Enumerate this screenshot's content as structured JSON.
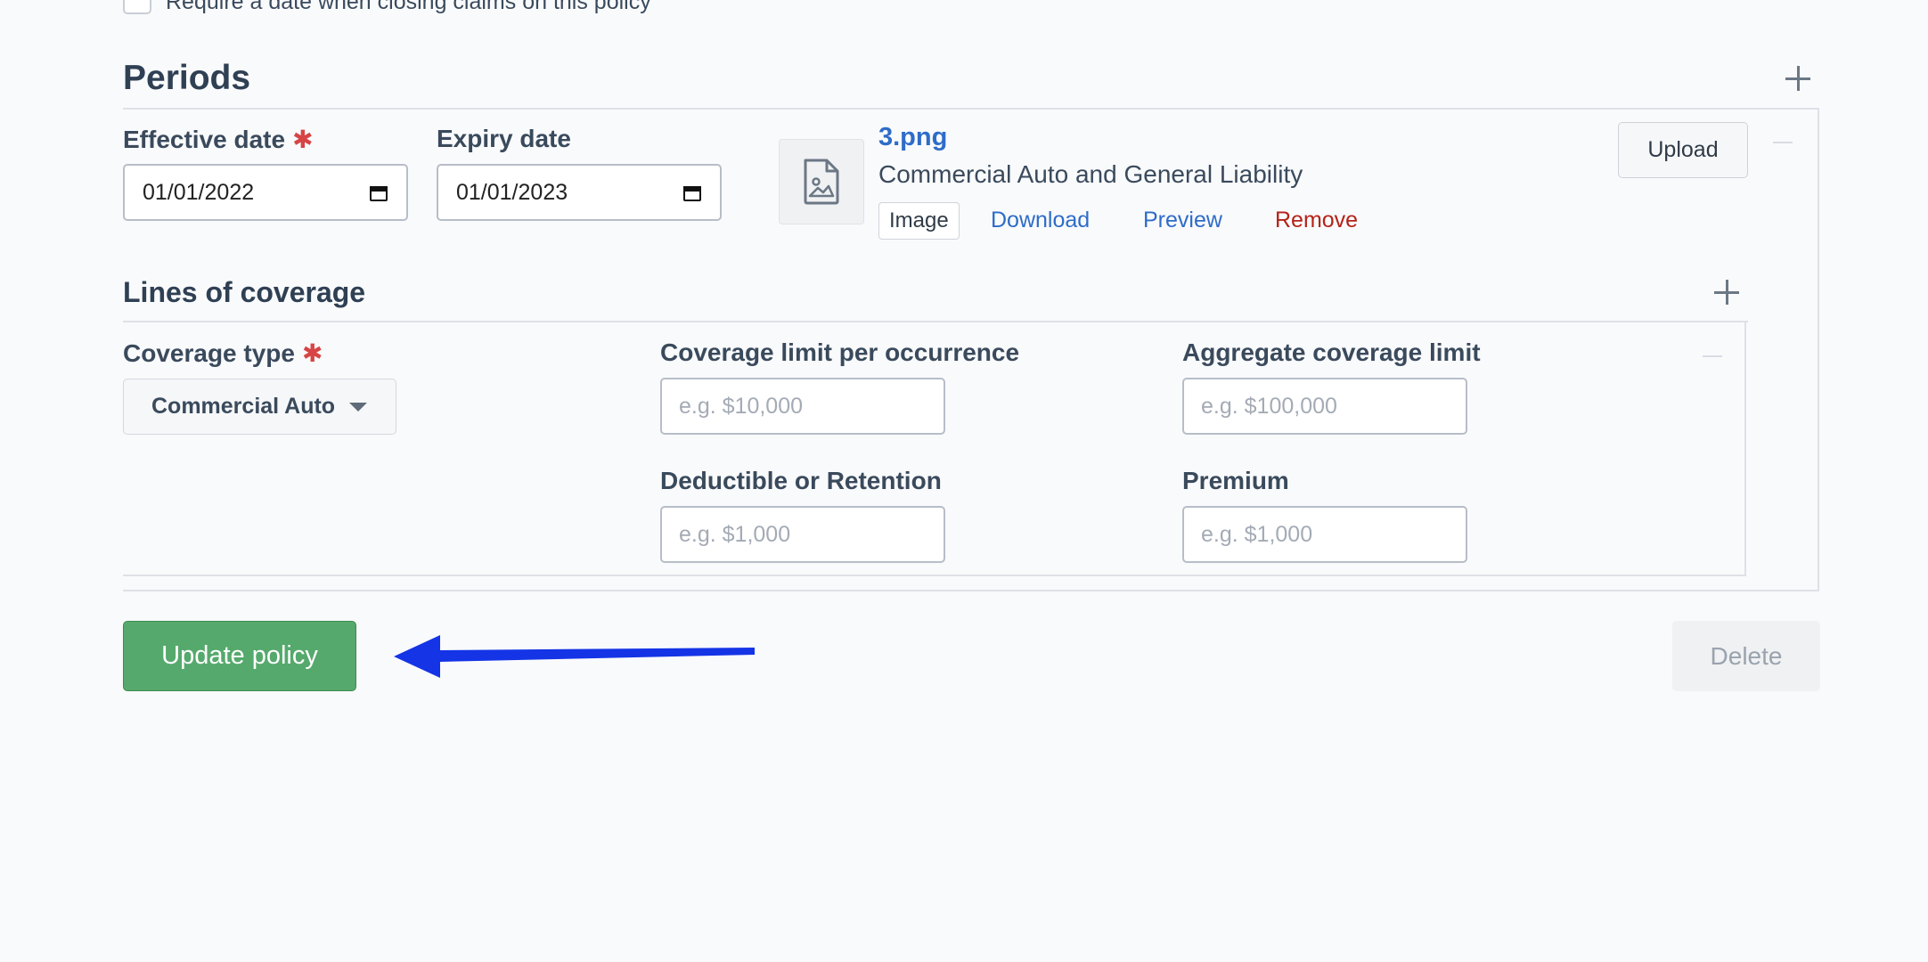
{
  "policy_options": {
    "require_date_label": "Require a date when closing claims on this policy"
  },
  "periods": {
    "title": "Periods",
    "add_icon": "plus-icon",
    "effective_date": {
      "label": "Effective date",
      "required_mark": "✱",
      "value": "01/01/2022"
    },
    "expiry_date": {
      "label": "Expiry date",
      "value": "01/01/2023"
    },
    "attachment": {
      "file_name": "3.png",
      "description": "Commercial Auto and General Liability",
      "type_badge": "Image",
      "download_label": "Download",
      "preview_label": "Preview",
      "remove_label": "Remove",
      "thumbnail_icon": "file-image-icon"
    },
    "upload_label": "Upload"
  },
  "lines_of_coverage": {
    "title": "Lines of coverage",
    "add_icon": "plus-icon",
    "coverage_type": {
      "label": "Coverage type",
      "required_mark": "✱",
      "selected": "Commercial Auto"
    },
    "limit_per_occurrence": {
      "label": "Coverage limit per occurrence",
      "placeholder": "e.g. $10,000"
    },
    "aggregate_limit": {
      "label": "Aggregate coverage limit",
      "placeholder": "e.g. $100,000"
    },
    "deductible": {
      "label": "Deductible or Retention",
      "placeholder": "e.g. $1,000"
    },
    "premium": {
      "label": "Premium",
      "placeholder": "e.g. $1,000"
    }
  },
  "actions": {
    "update_label": "Update policy",
    "delete_label": "Delete"
  },
  "colors": {
    "primary": "#55a96c",
    "link": "#2e6cc8",
    "danger": "#b42318",
    "required": "#d64545",
    "annotation_arrow": "#1434e6"
  }
}
